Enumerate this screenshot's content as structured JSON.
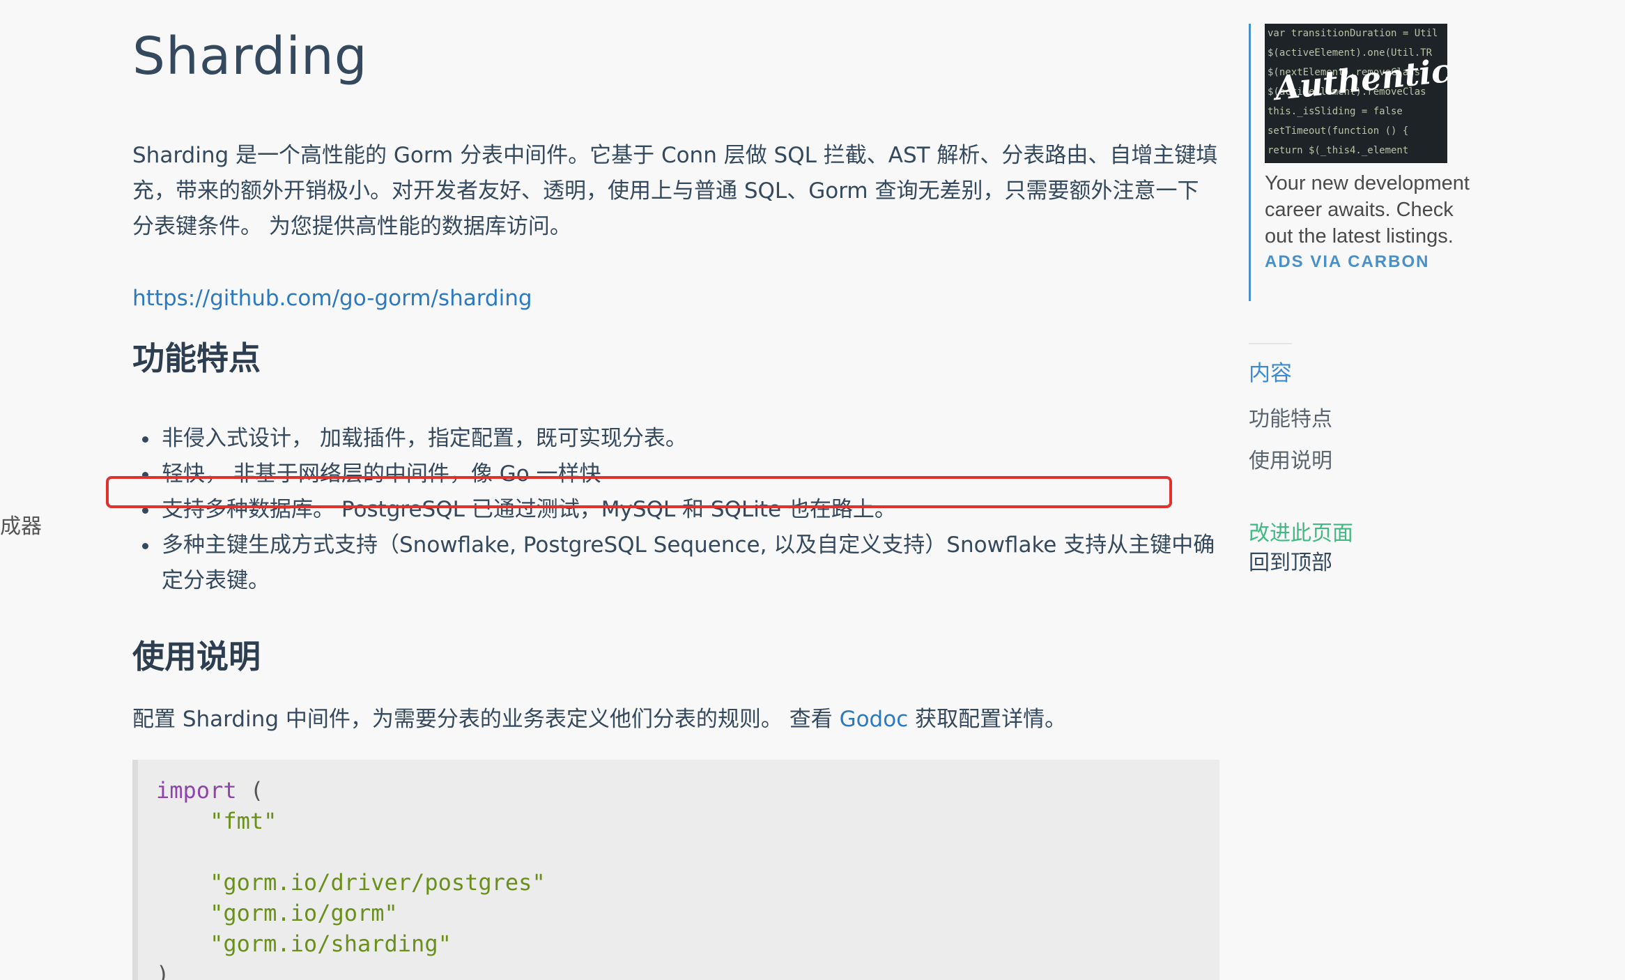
{
  "left_sidebar": {
    "fragment": "成器"
  },
  "main": {
    "title": "Sharding",
    "intro": "Sharding 是一个高性能的 Gorm 分表中间件。它基于 Conn 层做 SQL 拦截、AST 解析、分表路由、自增主键填充，带来的额外开销极小。对开发者友好、透明，使用上与普通 SQL、Gorm 查询无差别，只需要额外注意一下分表键条件。 为您提供高性能的数据库访问。",
    "repo_link": "https://github.com/go-gorm/sharding",
    "features_heading": "功能特点",
    "features": [
      "非侵入式设计， 加载插件，指定配置，既可实现分表。",
      "轻快， 非基于网络层的中间件，像 Go 一样快",
      "支持多种数据库。 PostgreSQL 已通过测试，MySQL 和 SQLite 也在路上。",
      "多种主键生成方式支持（Snowflake, PostgreSQL Sequence, 以及自定义支持）Snowflake 支持从主键中确定分表键。"
    ],
    "usage_heading": "使用说明",
    "usage_prefix": "配置 Sharding 中间件，为需要分表的业务表定义他们分表的规则。 查看 ",
    "usage_link": "Godoc",
    "usage_suffix": " 获取配置详情。",
    "code": {
      "keyword": "import",
      "open": " (",
      "imports": [
        "\"fmt\"",
        "",
        "\"gorm.io/driver/postgres\"",
        "\"gorm.io/gorm\"",
        "\"gorm.io/sharding\""
      ],
      "close": ")"
    }
  },
  "ad": {
    "image_code_lines": [
      "var transitionDuration = Util",
      "$(activeElement).one(Util.TR",
      "  $(nextElement).removeClass",
      "  $(activeElement).removeClas",
      "  this._isSliding = false",
      "  setTimeout(function () {",
      "    return $(_this4._element"
    ],
    "image_brand": "Authentic",
    "text": "Your new development career awaits. Check out the latest listings.",
    "via": "ADS VIA CARBON"
  },
  "toc": {
    "title": "内容",
    "items": [
      "功能特点",
      "使用说明"
    ],
    "edit_link": "改进此页面",
    "back_to_top": "回到顶部"
  },
  "colors": {
    "link": "#2b7ac1",
    "highlight_border": "#e0322c",
    "edit_link": "#42b983",
    "toc_title": "#3a8bd4"
  }
}
